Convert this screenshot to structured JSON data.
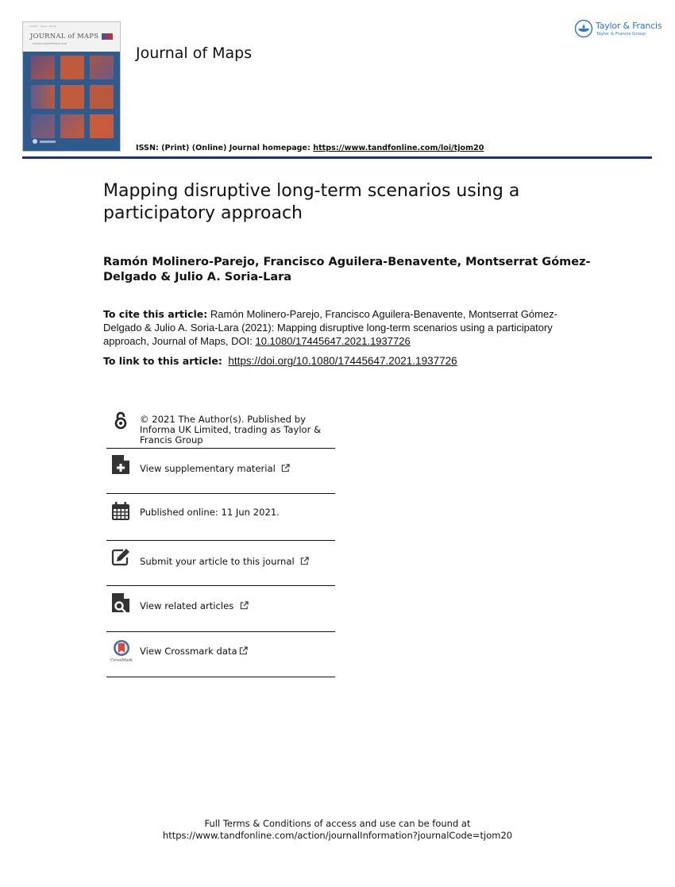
{
  "header": {
    "cover": {
      "journal_name": "JOURNAL of MAPS",
      "url": "www.journalofmaps.com"
    },
    "journal_title": "Journal of Maps",
    "publisher": {
      "name": "Taylor & Francis",
      "group": "Taylor & Francis Group",
      "brand_color": "#2f73c9"
    },
    "issn_label": "ISSN: (Print) (Online) Journal homepage:",
    "homepage_url": "https://www.tandfonline.com/loi/tjom20",
    "rule_color": "#1e2f7a"
  },
  "article": {
    "title": "Mapping disruptive long-term scenarios using a participatory approach",
    "authors": "Ramón Molinero-Parejo, Francisco Aguilera-Benavente, Montserrat Gómez-Delgado & Julio A. Soria-Lara",
    "cite_label": "To cite this article:",
    "cite_text": "Ramón Molinero-Parejo, Francisco Aguilera-Benavente, Montserrat Gómez-Delgado & Julio A. Soria-Lara (2021): Mapping disruptive long-term scenarios using a participatory approach, Journal of Maps, DOI: ",
    "doi": "10.1080/17445647.2021.1937726",
    "link_label": "To link to this article:",
    "link_url": "https://doi.org/10.1080/17445647.2021.1937726"
  },
  "info_items": [
    {
      "icon": "open-access-icon",
      "text": "© 2021 The Author(s). Published by Informa UK Limited, trading as Taylor & Francis Group",
      "external": false
    },
    {
      "icon": "supplementary-file-icon",
      "text": "View supplementary material",
      "external": true
    },
    {
      "icon": "calendar-icon",
      "text": "Published online: 11 Jun 2021.",
      "external": false
    },
    {
      "icon": "edit-icon",
      "text": "Submit your article to this journal",
      "external": true
    },
    {
      "icon": "search-document-icon",
      "text": "View related articles",
      "external": true
    },
    {
      "icon": "crossmark-icon",
      "text": "View Crossmark data",
      "external": true,
      "icon_caption": "CrossMark"
    }
  ],
  "footer": {
    "line1": "Full Terms & Conditions of access and use can be found at",
    "line2": "https://www.tandfonline.com/action/journalInformation?journalCode=tjom20"
  }
}
